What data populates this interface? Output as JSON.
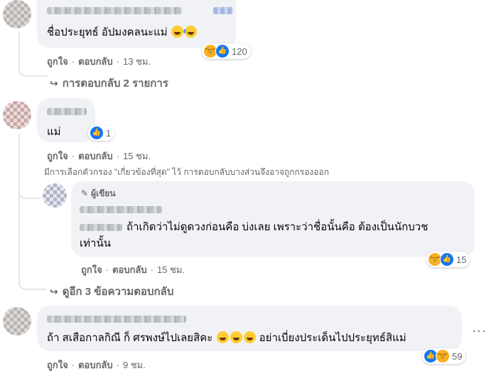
{
  "comment1": {
    "text": "ชื่อประยุทธ์ อัปมงคลนะแม่",
    "reaction_count": "120",
    "like_label": "ถูกใจ",
    "reply_label": "ตอบกลับ",
    "time": "13 ชม.",
    "replies_link": "การตอบกลับ 2 รายการ"
  },
  "comment2": {
    "text": "แม่",
    "reaction_count": "1",
    "like_label": "ถูกใจ",
    "reply_label": "ตอบกลับ",
    "time": "15 ชม."
  },
  "filter_note": "มีการเลือกตัวกรอง \"เกี่ยวข้องที่สุด\" ไว้ การตอบกลับบางส่วนจึงอาจถูกกรองออก",
  "reply1": {
    "author_badge": "ผู้เขียน",
    "text_line1": "ถ้าเกิดว่าไม่ดูดวงก่อนคือ บ่งเลย เพราะว่าชื่อนั้นคือ ต้องเป็นนักบวช",
    "text_line2": "เท่านั้น",
    "reaction_count": "15",
    "like_label": "ถูกใจ",
    "reply_label": "ตอบกลับ",
    "time": "15 ชม."
  },
  "more_replies": "ดูอีก 3 ข้อความตอบกลับ",
  "comment3": {
    "text_part1": "ถ้า สเสือกาลกิณี ก็ ศรพงษ์ไปเลยสิคะ",
    "text_part2": "อย่าเบี่ยงประเด็นไปประยุทธ์สิแม่",
    "reaction_count": "59",
    "like_label": "ถูกใจ",
    "reply_label": "ตอบกลับ",
    "time": "9 ชม.",
    "more_icon": "ellipsis-icon"
  },
  "colors": {
    "bubble": "#f0f2f5",
    "secondary_text": "#65676b",
    "like_blue": "#1877f2",
    "haha_yellow": "#f7b125"
  }
}
